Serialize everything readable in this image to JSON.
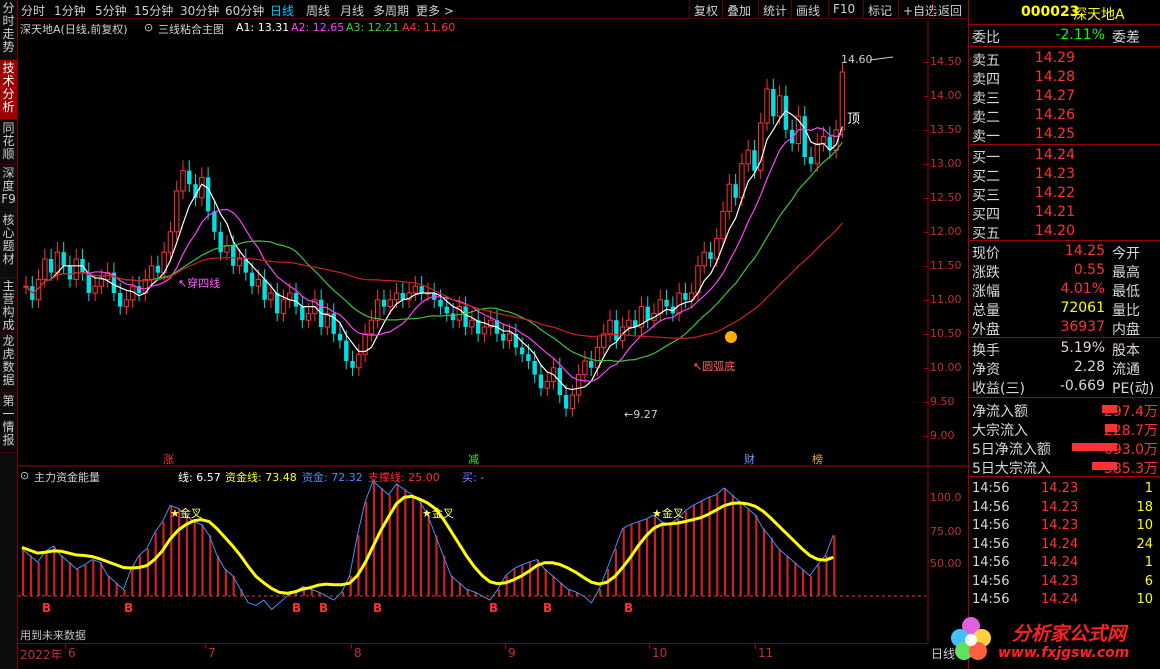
{
  "left_tabs": [
    {
      "label": "分时走势",
      "active": false
    },
    {
      "label": "技术分析",
      "active": true
    },
    {
      "label": "同花顺",
      "active": false
    },
    {
      "label": "深度F9",
      "active": false
    },
    {
      "label": "核心题材",
      "active": false
    },
    {
      "label": "主营构成",
      "active": false
    },
    {
      "label": "龙虎数据",
      "active": false
    },
    {
      "label": "第一情报",
      "active": false
    }
  ],
  "toolbar": {
    "periods": [
      "分时",
      "1分钟",
      "5分钟",
      "15分钟",
      "30分钟",
      "60分钟",
      "日线",
      "周线",
      "月线",
      "多周期",
      "更多 >"
    ],
    "active_period": "日线",
    "right_buttons": [
      "复权",
      "叠加",
      "统计",
      "画线",
      "F10",
      "标记",
      "+自选",
      "返回"
    ]
  },
  "main_legend": {
    "title": "深天地A(日线,前复权)",
    "indicator": "三线粘合主图",
    "a1": "A1: 13.31",
    "a2": "A2: 12.65",
    "a3": "A3: 12.21",
    "a4": "A4: 11.60"
  },
  "price_axis": [
    "14.50",
    "14.00",
    "13.50",
    "13.00",
    "12.50",
    "12.00",
    "11.50",
    "11.00",
    "10.50",
    "10.00",
    "9.50",
    "9.00"
  ],
  "annotations": {
    "high": "14.60",
    "low": "9.27",
    "top": "顶",
    "cross4": "穿四线",
    "arc_bottom": "圆弧底",
    "tag_zhang": "涨",
    "tag_jian": "减",
    "tag_cai": "财",
    "tag_bang": "榜"
  },
  "sub_legend": {
    "title": "主力资金能量",
    "line": "线: 6.57",
    "fund_line": "资金线: 73.48",
    "fund": "资金: 72.32",
    "support": "支撑线: 25.00",
    "buy": "买: -"
  },
  "sub_axis": [
    "100.0",
    "75.00",
    "50.00"
  ],
  "sub_annotations": {
    "golden_cross": "金叉",
    "buy_letter": "B",
    "future_note": "用到未来数据"
  },
  "x_axis": [
    "2022年",
    "6",
    "7",
    "8",
    "9",
    "10",
    "11"
  ],
  "bottom_right": "日线",
  "colors": {
    "up": "#ff3232",
    "down": "#00e0e0",
    "ma_white": "#ffffff",
    "ma_magenta": "#ff40ff",
    "ma_green": "#40c040",
    "ma_red": "#d02020",
    "fund_yellow": "#ffff00",
    "fund_blue": "#4090ff"
  },
  "quote": {
    "code": "000023",
    "name": "深天地A",
    "weibi_label": "委比",
    "weibi_value": "-2.11%",
    "weicha_label": "委差",
    "asks": [
      {
        "label": "卖五",
        "price": "14.29"
      },
      {
        "label": "卖四",
        "price": "14.28"
      },
      {
        "label": "卖三",
        "price": "14.27"
      },
      {
        "label": "卖二",
        "price": "14.26"
      },
      {
        "label": "卖一",
        "price": "14.25"
      }
    ],
    "bids": [
      {
        "label": "买一",
        "price": "14.24"
      },
      {
        "label": "买二",
        "price": "14.23"
      },
      {
        "label": "买三",
        "price": "14.22"
      },
      {
        "label": "买四",
        "price": "14.21"
      },
      {
        "label": "买五",
        "price": "14.20"
      }
    ],
    "stats": [
      {
        "label": "现价",
        "value": "14.25",
        "label2": "今开",
        "color": "#ff3232"
      },
      {
        "label": "涨跌",
        "value": "0.55",
        "label2": "最高",
        "color": "#ff3232"
      },
      {
        "label": "涨幅",
        "value": "4.01%",
        "label2": "最低",
        "color": "#ff3232"
      },
      {
        "label": "总量",
        "value": "72061",
        "label2": "量比",
        "color": "#ffff00"
      },
      {
        "label": "外盘",
        "value": "36937",
        "label2": "内盘",
        "color": "#ff3232"
      }
    ],
    "stats2": [
      {
        "label": "换手",
        "value": "5.19%",
        "label2": "股本"
      },
      {
        "label": "净资",
        "value": "2.28",
        "label2": "流通"
      },
      {
        "label": "收益(三)",
        "value": "-0.669",
        "label2": "PE(动)"
      }
    ],
    "flows": [
      {
        "label": "净流入额",
        "value": "297.4万",
        "bar": 0.3
      },
      {
        "label": "大宗流入",
        "value": "228.7万",
        "bar": 0.25
      },
      {
        "label": "5日净流入额",
        "value": "693.0万",
        "bar": 0.9
      },
      {
        "label": "5日大宗流入",
        "value": "385.3万",
        "bar": 0.5
      }
    ],
    "ticks": [
      {
        "time": "14:56",
        "price": "14.23",
        "vol": "1"
      },
      {
        "time": "14:56",
        "price": "14.23",
        "vol": "18"
      },
      {
        "time": "14:56",
        "price": "14.23",
        "vol": "10"
      },
      {
        "time": "14:56",
        "price": "14.24",
        "vol": "24"
      },
      {
        "time": "14:56",
        "price": "14.24",
        "vol": "1"
      },
      {
        "time": "14:56",
        "price": "14.23",
        "vol": "6"
      },
      {
        "time": "14:56",
        "price": "14.24",
        "vol": "10"
      }
    ]
  },
  "watermark": {
    "text": "分析家公式网",
    "url": "www.fxjgsw.com"
  }
}
